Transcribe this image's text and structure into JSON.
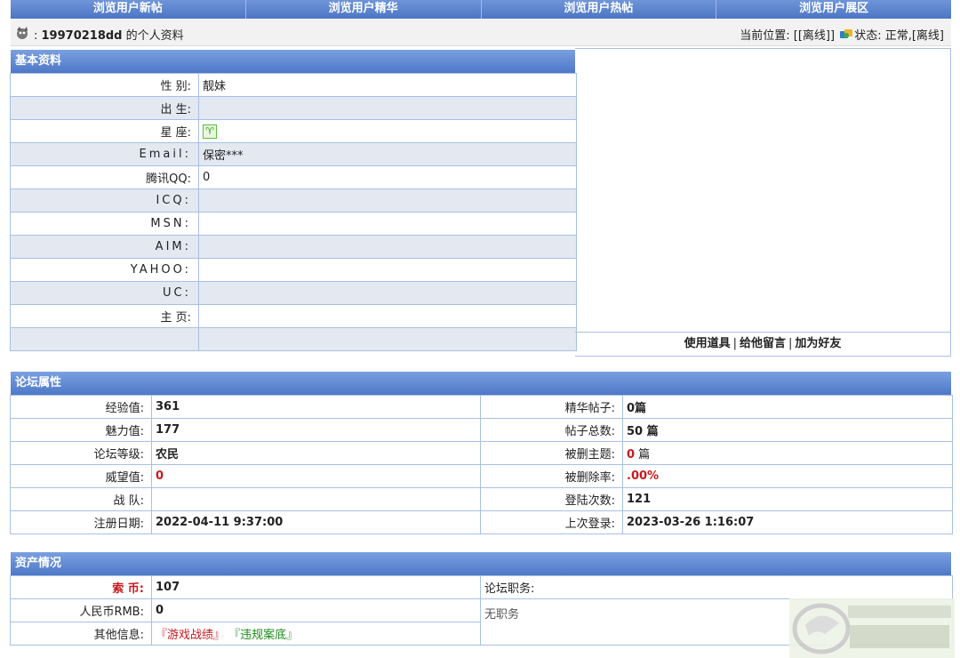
{
  "topnav": [
    "浏览用户新帖",
    "浏览用户精华",
    "浏览用户热帖",
    "浏览用户展区"
  ],
  "infobar": {
    "username": "19970218dd",
    "suffix": " 的个人资料",
    "location_label": "当前位置: [[离线]]",
    "status_text": "状态:  正常,[离线]"
  },
  "basic": {
    "title": "基本资料",
    "rows": [
      {
        "label": "性 别:",
        "value": "靓妹"
      },
      {
        "label": "出 生:",
        "value": ""
      },
      {
        "label": "星 座:",
        "value": "♈"
      },
      {
        "label": "Email:",
        "value": "保密***"
      },
      {
        "label": "腾讯QQ:",
        "value": "0"
      },
      {
        "label": "ICQ:",
        "value": ""
      },
      {
        "label": "MSN:",
        "value": ""
      },
      {
        "label": "AIM:",
        "value": ""
      },
      {
        "label": "YAHOO:",
        "value": ""
      },
      {
        "label": "UC:",
        "value": ""
      },
      {
        "label": "主 页:",
        "value": ""
      }
    ],
    "actions": {
      "use_item": "使用道具",
      "leave_msg": "给他留言",
      "add_friend": "加为好友",
      "sep": "|"
    }
  },
  "forum": {
    "title": "论坛属性",
    "rows": [
      {
        "l1": "经验值:",
        "v1": "361",
        "l2": "精华帖子:",
        "v2": "0篇"
      },
      {
        "l1": "魅力值:",
        "v1": "177",
        "l2": "帖子总数:",
        "v2": "50 篇"
      },
      {
        "l1": "论坛等级:",
        "v1": "农民",
        "l2": "被删主题:",
        "v2a": "0",
        "v2b": " 篇"
      },
      {
        "l1": "威望值:",
        "v1": "0",
        "l2": "被删除率:",
        "v2": ".00%"
      },
      {
        "l1": "战 队:",
        "v1": "",
        "l2": "登陆次数:",
        "v2": "121"
      },
      {
        "l1": "注册日期:",
        "v1": "2022-04-11 9:37:00",
        "l2": "上次登录:",
        "v2": "2023-03-26 1:16:07"
      }
    ]
  },
  "assets": {
    "title": "资产情况",
    "rows": [
      {
        "label": "索 币:",
        "value": "107"
      },
      {
        "label": "人民币RMB:",
        "value": "0"
      },
      {
        "label": "其他信息:",
        "link1": "『游戏战绩』",
        "link2": "『违规案底』"
      }
    ],
    "duty_label": "论坛职务:",
    "duty_value": "无职务"
  }
}
